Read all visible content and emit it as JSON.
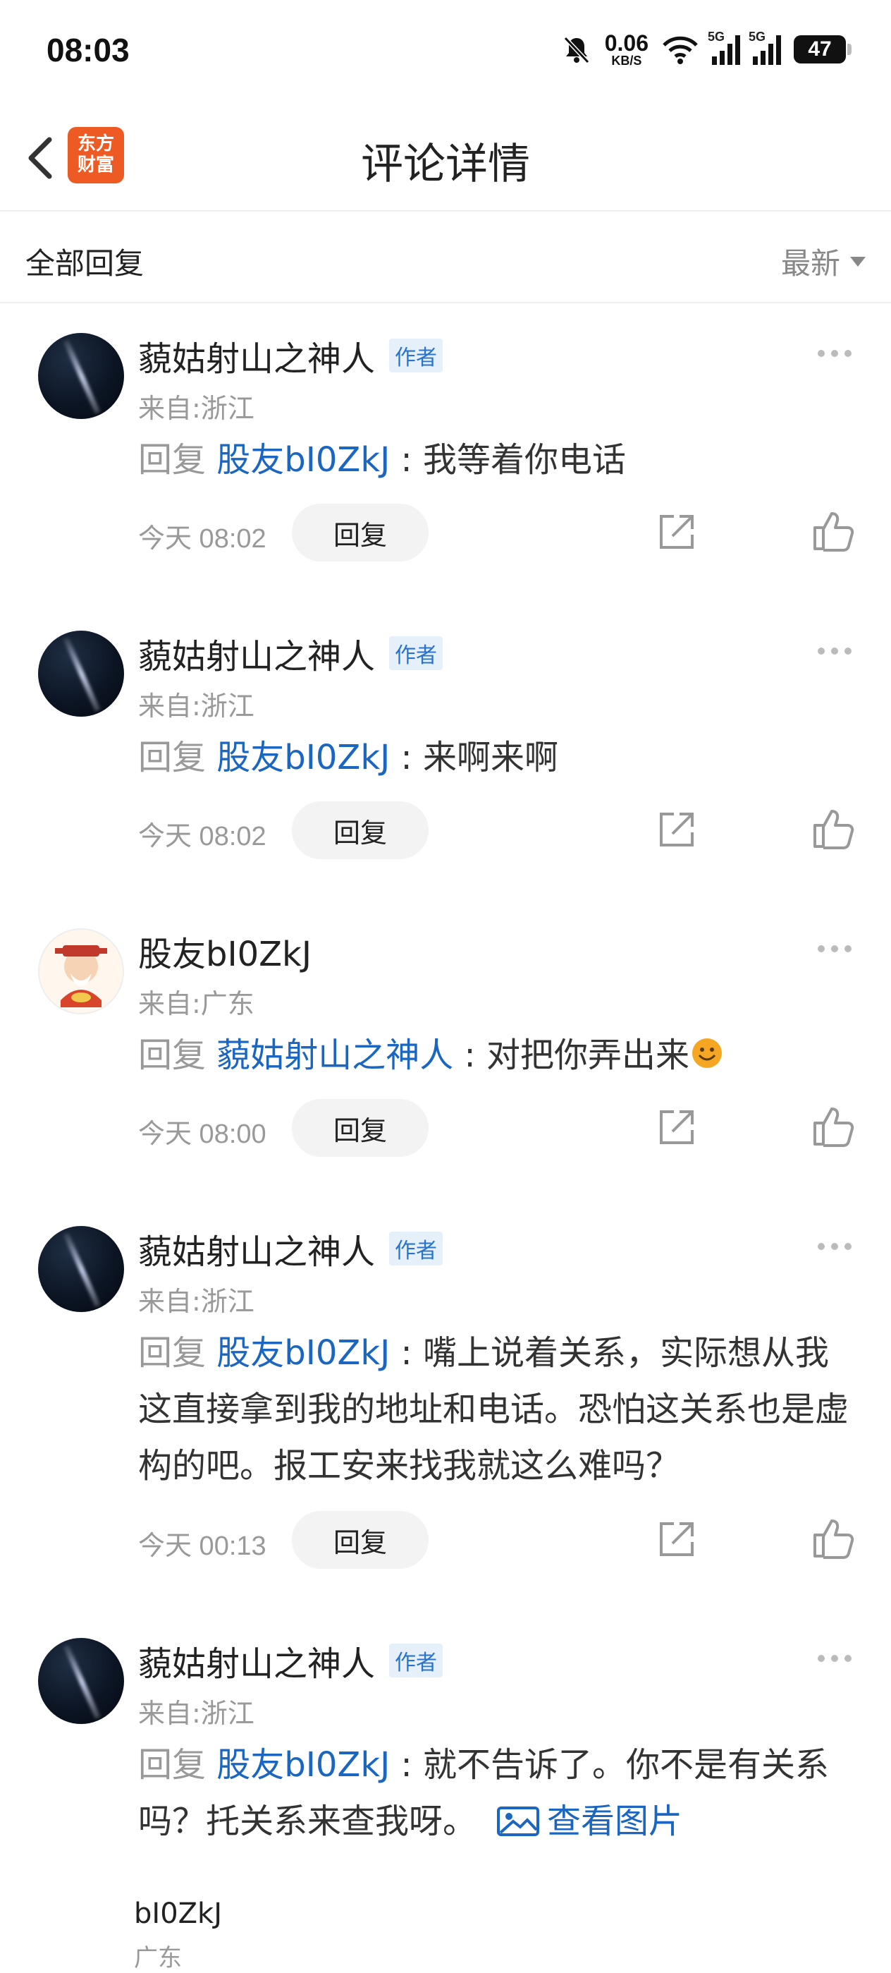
{
  "status": {
    "time": "08:03",
    "net_speed_value": "0.06",
    "net_speed_unit": "KB/S",
    "signal1_label": "5G",
    "signal2_label": "5G",
    "battery": "47"
  },
  "header": {
    "logo_line1": "东方",
    "logo_line2": "财富",
    "title": "评论详情"
  },
  "filter": {
    "all_replies": "全部回复",
    "sort": "最新"
  },
  "comments": [
    {
      "name": "藐姑射山之神人",
      "badge": "作者",
      "location": "来自:浙江",
      "reply_prefix": "回复 ",
      "reply_to": "股友bI0ZkJ",
      "sep": " : ",
      "text": "我等着你电话",
      "time": "今天 08:02",
      "reply_btn": "回复"
    },
    {
      "name": "藐姑射山之神人",
      "badge": "作者",
      "location": "来自:浙江",
      "reply_prefix": "回复 ",
      "reply_to": "股友bI0ZkJ",
      "sep": " : ",
      "text": "来啊来啊",
      "time": "今天 08:02",
      "reply_btn": "回复"
    },
    {
      "name": "股友bI0ZkJ",
      "location": "来自:广东",
      "reply_prefix": "回复 ",
      "reply_to": "藐姑射山之神人",
      "sep": " : ",
      "text": "对把你弄出来",
      "time": "今天 08:00",
      "reply_btn": "回复"
    },
    {
      "name": "藐姑射山之神人",
      "badge": "作者",
      "location": "来自:浙江",
      "reply_prefix": "回复 ",
      "reply_to": "股友bI0ZkJ",
      "sep": " : ",
      "text": "嘴上说着关系，实际想从我这直接拿到我的地址和电话。恐怕这关系也是虚构的吧。报工安来找我就这么难吗？",
      "time": "今天 00:13",
      "reply_btn": "回复"
    },
    {
      "name": "藐姑射山之神人",
      "badge": "作者",
      "location": "来自:浙江",
      "reply_prefix": "回复 ",
      "reply_to": "股友bI0ZkJ",
      "sep": " : ",
      "text": "就不告诉了。你不是有关系吗？托关系来查我呀。",
      "view_image": "查看图片"
    }
  ],
  "partial_next": {
    "name": "bI0ZkJ",
    "location": "广东"
  }
}
